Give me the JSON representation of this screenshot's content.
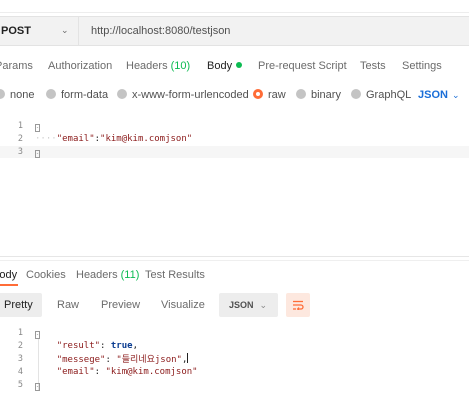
{
  "request": {
    "method": "POST",
    "url": "http://localhost:8080/testjson"
  },
  "request_tabs": [
    {
      "label": "Params",
      "active": false
    },
    {
      "label": "Authorization",
      "active": false
    },
    {
      "label": "Headers",
      "count": "(10)",
      "active": false
    },
    {
      "label": "Body",
      "active": true
    },
    {
      "label": "Pre-request Script",
      "active": false
    },
    {
      "label": "Tests",
      "active": false
    },
    {
      "label": "Settings",
      "active": false
    }
  ],
  "body_types": [
    {
      "label": "none",
      "selected": false
    },
    {
      "label": "form-data",
      "selected": false
    },
    {
      "label": "x-www-form-urlencoded",
      "selected": false
    },
    {
      "label": "raw",
      "selected": true
    },
    {
      "label": "binary",
      "selected": false
    },
    {
      "label": "GraphQL",
      "selected": false
    }
  ],
  "body_format": "JSON",
  "request_body": {
    "line_numbers": [
      "1",
      "2",
      "3"
    ],
    "key": "\"email\"",
    "colon": ":",
    "value": "\"kim@kim.comjson\""
  },
  "response_tabs": [
    {
      "label": "Body",
      "active": true
    },
    {
      "label": "Cookies",
      "active": false
    },
    {
      "label": "Headers",
      "count": "(11)",
      "active": false
    },
    {
      "label": "Test Results",
      "active": false
    }
  ],
  "response_views": [
    "Pretty",
    "Raw",
    "Preview",
    "Visualize"
  ],
  "response_format": "JSON",
  "response_body": {
    "line_numbers": [
      "1",
      "2",
      "3",
      "4",
      "5"
    ],
    "result_key": "\"result\"",
    "result_value": "true",
    "messege_key": "\"messege\"",
    "messege_value": "\"들리네요json\"",
    "email_key": "\"email\"",
    "email_value": "\"kim@kim.comjson\""
  },
  "colors": {
    "accent": "#ff6c37",
    "green": "#0cbb52",
    "link_blue": "#1a6ed8"
  }
}
